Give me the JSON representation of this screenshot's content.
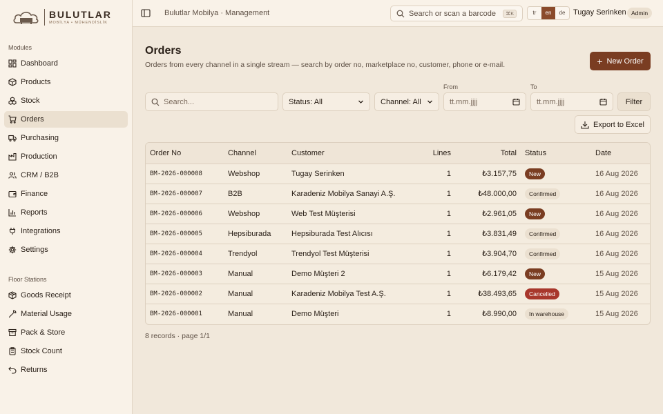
{
  "brand": {
    "name": "BULUTLAR",
    "tagline": "MOBİLYA • MÜHENDİSLİK"
  },
  "topbar": {
    "breadcrumb": "Bulutlar Mobilya · Management",
    "search_placeholder": "Search or scan a barcode",
    "search_shortcut": "⌘K",
    "languages": [
      "tr",
      "en",
      "de"
    ],
    "active_language": "en",
    "user_name": "Tugay Serinken",
    "user_role": "Admin"
  },
  "sidebar": {
    "modules_label": "Modules",
    "modules": [
      {
        "label": "Dashboard",
        "icon": "dashboard-icon"
      },
      {
        "label": "Products",
        "icon": "box-icon"
      },
      {
        "label": "Stock",
        "icon": "boxes-icon"
      },
      {
        "label": "Orders",
        "icon": "cart-icon",
        "active": true
      },
      {
        "label": "Purchasing",
        "icon": "truck-icon"
      },
      {
        "label": "Production",
        "icon": "factory-icon"
      },
      {
        "label": "CRM / B2B",
        "icon": "users-icon"
      },
      {
        "label": "Finance",
        "icon": "wallet-icon"
      },
      {
        "label": "Reports",
        "icon": "bar-chart-icon"
      },
      {
        "label": "Integrations",
        "icon": "plug-icon"
      },
      {
        "label": "Settings",
        "icon": "gear-icon"
      }
    ],
    "floor_label": "Floor Stations",
    "floor": [
      {
        "label": "Goods Receipt",
        "icon": "package-icon"
      },
      {
        "label": "Material Usage",
        "icon": "wrench-icon"
      },
      {
        "label": "Pack & Store",
        "icon": "archive-icon"
      },
      {
        "label": "Stock Count",
        "icon": "clipboard-icon"
      },
      {
        "label": "Returns",
        "icon": "undo-icon"
      }
    ]
  },
  "page": {
    "title": "Orders",
    "subtitle": "Orders from every channel in a single stream — search by order no, marketplace no, customer, phone or e-mail.",
    "new_order_label": "New Order"
  },
  "filters": {
    "search_placeholder": "Search...",
    "status": "Status: All",
    "channel": "Channel: All",
    "from_label": "From",
    "to_label": "To",
    "date_placeholder": "tt.mm.jjjj",
    "filter_button": "Filter",
    "export_button": "Export to Excel"
  },
  "table": {
    "columns": [
      "Order No",
      "Channel",
      "Customer",
      "Lines",
      "Total",
      "Status",
      "Date"
    ],
    "rows": [
      {
        "order_no": "BM-2026-000008",
        "channel": "Webshop",
        "customer": "Tugay Serinken",
        "lines": "1",
        "total": "₺3.157,75",
        "status": "New",
        "status_kind": "new",
        "date": "16 Aug 2026"
      },
      {
        "order_no": "BM-2026-000007",
        "channel": "B2B",
        "customer": "Karadeniz Mobilya Sanayi A.Ş.",
        "lines": "1",
        "total": "₺48.000,00",
        "status": "Confirmed",
        "status_kind": "confirmed",
        "date": "16 Aug 2026"
      },
      {
        "order_no": "BM-2026-000006",
        "channel": "Webshop",
        "customer": "Web Test Müşterisi",
        "lines": "1",
        "total": "₺2.961,05",
        "status": "New",
        "status_kind": "new",
        "date": "16 Aug 2026"
      },
      {
        "order_no": "BM-2026-000005",
        "channel": "Hepsiburada",
        "customer": "Hepsiburada Test Alıcısı",
        "lines": "1",
        "total": "₺3.831,49",
        "status": "Confirmed",
        "status_kind": "confirmed",
        "date": "16 Aug 2026"
      },
      {
        "order_no": "BM-2026-000004",
        "channel": "Trendyol",
        "customer": "Trendyol Test Müşterisi",
        "lines": "1",
        "total": "₺3.904,70",
        "status": "Confirmed",
        "status_kind": "confirmed",
        "date": "16 Aug 2026"
      },
      {
        "order_no": "BM-2026-000003",
        "channel": "Manual",
        "customer": "Demo Müşteri 2",
        "lines": "1",
        "total": "₺6.179,42",
        "status": "New",
        "status_kind": "new",
        "date": "15 Aug 2026"
      },
      {
        "order_no": "BM-2026-000002",
        "channel": "Manual",
        "customer": "Karadeniz Mobilya Test A.Ş.",
        "lines": "1",
        "total": "₺38.493,65",
        "status": "Cancelled",
        "status_kind": "cancelled",
        "date": "15 Aug 2026"
      },
      {
        "order_no": "BM-2026-000001",
        "channel": "Manual",
        "customer": "Demo Müşteri",
        "lines": "1",
        "total": "₺8.990,00",
        "status": "In warehouse",
        "status_kind": "warehouse",
        "date": "15 Aug 2026"
      }
    ],
    "records_text": "8 records · page 1/1"
  },
  "colors": {
    "accent": "#7a3d22",
    "cancelled": "#a8372c",
    "background": "#f1e8db",
    "sidebar": "#f9f2e8"
  }
}
